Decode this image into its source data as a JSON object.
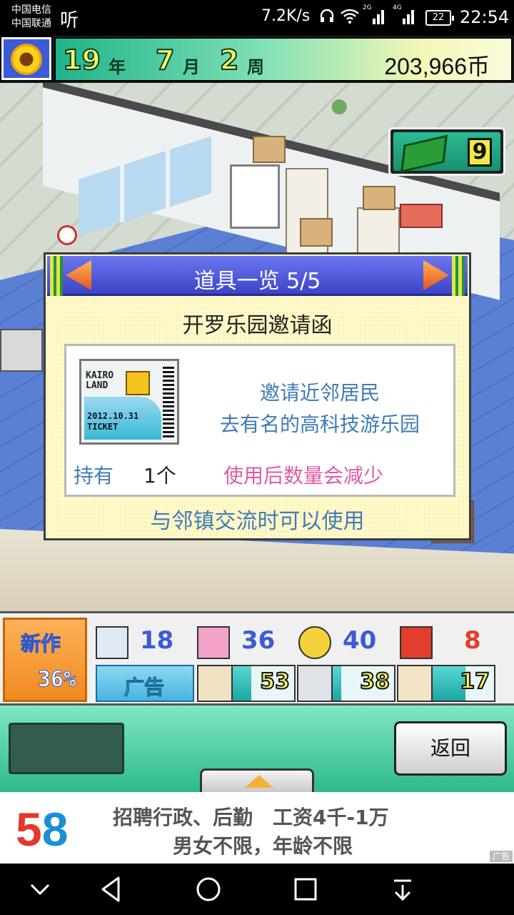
{
  "status_bar": {
    "carrier_1": "中国电信",
    "carrier_2": "中国联通",
    "listen_app": "听",
    "net_speed": "7.2K/s",
    "signal_1": "2G",
    "signal_2": "4G",
    "battery": "22",
    "time": "22:54"
  },
  "hud": {
    "year": "19",
    "year_unit": "年",
    "month": "7",
    "month_unit": "月",
    "week": "2",
    "week_unit": "周",
    "money": "203,966币",
    "inventory_count": "9"
  },
  "dialog": {
    "title": "道具一览 5/5",
    "item_name": "开罗乐园邀请函",
    "ticket_brand_line1": "KAIRO",
    "ticket_brand_line2": "LAND",
    "ticket_date": "2012.10.31",
    "ticket_label": "TICKET",
    "description_line1": "邀请近邻居民",
    "description_line2": "去有名的高科技游乐园",
    "held_label": "持有",
    "held_count": "1个",
    "held_note": "使用后数量会减少",
    "usage": "与邻镇交流时可以使用"
  },
  "stats": {
    "new_label": "新作",
    "new_percent": "36%",
    "ad_label": "广告",
    "items": [
      {
        "icon": "document-icon",
        "value": "18",
        "color": "#3b5bd7"
      },
      {
        "icon": "computer-icon",
        "value": "36",
        "color": "#3b5bd7"
      },
      {
        "icon": "smiley-icon",
        "value": "40",
        "color": "#3b5bd7"
      },
      {
        "icon": "bug-icon",
        "value": "8",
        "color": "#e23d2d"
      }
    ],
    "gauges": [
      {
        "icon": "painting-icon",
        "value": "53",
        "fill": 0.55
      },
      {
        "icon": "sound-icon",
        "value": "38",
        "fill": 0.45
      },
      {
        "icon": "character-icon",
        "value": "17",
        "fill": 0.7
      }
    ]
  },
  "controls": {
    "back_label": "返回"
  },
  "ad_banner": {
    "logo_5": "5",
    "logo_8": "8",
    "line1": "招聘行政、后勤　工资4千-1万",
    "line2": "男女不限，年龄不限",
    "tag": "广告"
  }
}
